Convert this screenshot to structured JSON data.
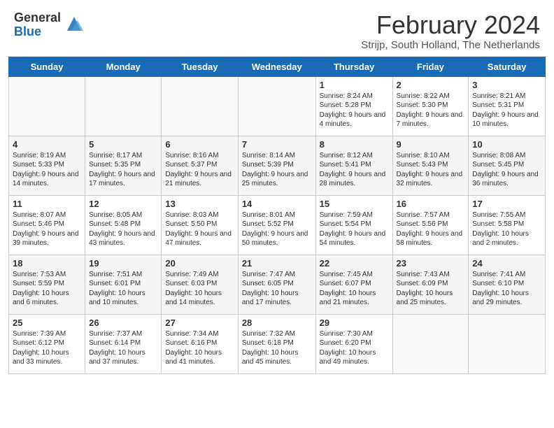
{
  "header": {
    "logo_general": "General",
    "logo_blue": "Blue",
    "title": "February 2024",
    "location": "Strijp, South Holland, The Netherlands"
  },
  "days_of_week": [
    "Sunday",
    "Monday",
    "Tuesday",
    "Wednesday",
    "Thursday",
    "Friday",
    "Saturday"
  ],
  "weeks": [
    [
      {
        "day": "",
        "info": ""
      },
      {
        "day": "",
        "info": ""
      },
      {
        "day": "",
        "info": ""
      },
      {
        "day": "",
        "info": ""
      },
      {
        "day": "1",
        "info": "Sunrise: 8:24 AM\nSunset: 5:28 PM\nDaylight: 9 hours\nand 4 minutes."
      },
      {
        "day": "2",
        "info": "Sunrise: 8:22 AM\nSunset: 5:30 PM\nDaylight: 9 hours\nand 7 minutes."
      },
      {
        "day": "3",
        "info": "Sunrise: 8:21 AM\nSunset: 5:31 PM\nDaylight: 9 hours\nand 10 minutes."
      }
    ],
    [
      {
        "day": "4",
        "info": "Sunrise: 8:19 AM\nSunset: 5:33 PM\nDaylight: 9 hours\nand 14 minutes."
      },
      {
        "day": "5",
        "info": "Sunrise: 8:17 AM\nSunset: 5:35 PM\nDaylight: 9 hours\nand 17 minutes."
      },
      {
        "day": "6",
        "info": "Sunrise: 8:16 AM\nSunset: 5:37 PM\nDaylight: 9 hours\nand 21 minutes."
      },
      {
        "day": "7",
        "info": "Sunrise: 8:14 AM\nSunset: 5:39 PM\nDaylight: 9 hours\nand 25 minutes."
      },
      {
        "day": "8",
        "info": "Sunrise: 8:12 AM\nSunset: 5:41 PM\nDaylight: 9 hours\nand 28 minutes."
      },
      {
        "day": "9",
        "info": "Sunrise: 8:10 AM\nSunset: 5:43 PM\nDaylight: 9 hours\nand 32 minutes."
      },
      {
        "day": "10",
        "info": "Sunrise: 8:08 AM\nSunset: 5:45 PM\nDaylight: 9 hours\nand 36 minutes."
      }
    ],
    [
      {
        "day": "11",
        "info": "Sunrise: 8:07 AM\nSunset: 5:46 PM\nDaylight: 9 hours\nand 39 minutes."
      },
      {
        "day": "12",
        "info": "Sunrise: 8:05 AM\nSunset: 5:48 PM\nDaylight: 9 hours\nand 43 minutes."
      },
      {
        "day": "13",
        "info": "Sunrise: 8:03 AM\nSunset: 5:50 PM\nDaylight: 9 hours\nand 47 minutes."
      },
      {
        "day": "14",
        "info": "Sunrise: 8:01 AM\nSunset: 5:52 PM\nDaylight: 9 hours\nand 50 minutes."
      },
      {
        "day": "15",
        "info": "Sunrise: 7:59 AM\nSunset: 5:54 PM\nDaylight: 9 hours\nand 54 minutes."
      },
      {
        "day": "16",
        "info": "Sunrise: 7:57 AM\nSunset: 5:56 PM\nDaylight: 9 hours\nand 58 minutes."
      },
      {
        "day": "17",
        "info": "Sunrise: 7:55 AM\nSunset: 5:58 PM\nDaylight: 10 hours\nand 2 minutes."
      }
    ],
    [
      {
        "day": "18",
        "info": "Sunrise: 7:53 AM\nSunset: 5:59 PM\nDaylight: 10 hours\nand 6 minutes."
      },
      {
        "day": "19",
        "info": "Sunrise: 7:51 AM\nSunset: 6:01 PM\nDaylight: 10 hours\nand 10 minutes."
      },
      {
        "day": "20",
        "info": "Sunrise: 7:49 AM\nSunset: 6:03 PM\nDaylight: 10 hours\nand 14 minutes."
      },
      {
        "day": "21",
        "info": "Sunrise: 7:47 AM\nSunset: 6:05 PM\nDaylight: 10 hours\nand 17 minutes."
      },
      {
        "day": "22",
        "info": "Sunrise: 7:45 AM\nSunset: 6:07 PM\nDaylight: 10 hours\nand 21 minutes."
      },
      {
        "day": "23",
        "info": "Sunrise: 7:43 AM\nSunset: 6:09 PM\nDaylight: 10 hours\nand 25 minutes."
      },
      {
        "day": "24",
        "info": "Sunrise: 7:41 AM\nSunset: 6:10 PM\nDaylight: 10 hours\nand 29 minutes."
      }
    ],
    [
      {
        "day": "25",
        "info": "Sunrise: 7:39 AM\nSunset: 6:12 PM\nDaylight: 10 hours\nand 33 minutes."
      },
      {
        "day": "26",
        "info": "Sunrise: 7:37 AM\nSunset: 6:14 PM\nDaylight: 10 hours\nand 37 minutes."
      },
      {
        "day": "27",
        "info": "Sunrise: 7:34 AM\nSunset: 6:16 PM\nDaylight: 10 hours\nand 41 minutes."
      },
      {
        "day": "28",
        "info": "Sunrise: 7:32 AM\nSunset: 6:18 PM\nDaylight: 10 hours\nand 45 minutes."
      },
      {
        "day": "29",
        "info": "Sunrise: 7:30 AM\nSunset: 6:20 PM\nDaylight: 10 hours\nand 49 minutes."
      },
      {
        "day": "",
        "info": ""
      },
      {
        "day": "",
        "info": ""
      }
    ]
  ]
}
